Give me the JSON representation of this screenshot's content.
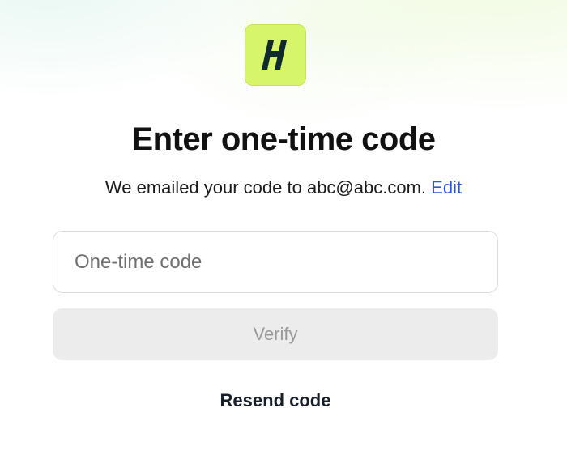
{
  "brand": {
    "logo_icon": "brand-h-logo-icon",
    "logo_bg_color": "#d7f56a",
    "logo_fg_color": "#0f2a2a"
  },
  "heading": {
    "title": "Enter one-time code"
  },
  "message": {
    "text": "We emailed your code to abc@abc.com.",
    "edit_label": "Edit"
  },
  "form": {
    "code_value": "",
    "code_placeholder": "One-time code",
    "verify_label": "Verify",
    "resend_label": "Resend code"
  },
  "colors": {
    "link": "#2f55d4",
    "button_disabled_bg": "#ececec",
    "button_disabled_text": "#9a9a9a"
  }
}
